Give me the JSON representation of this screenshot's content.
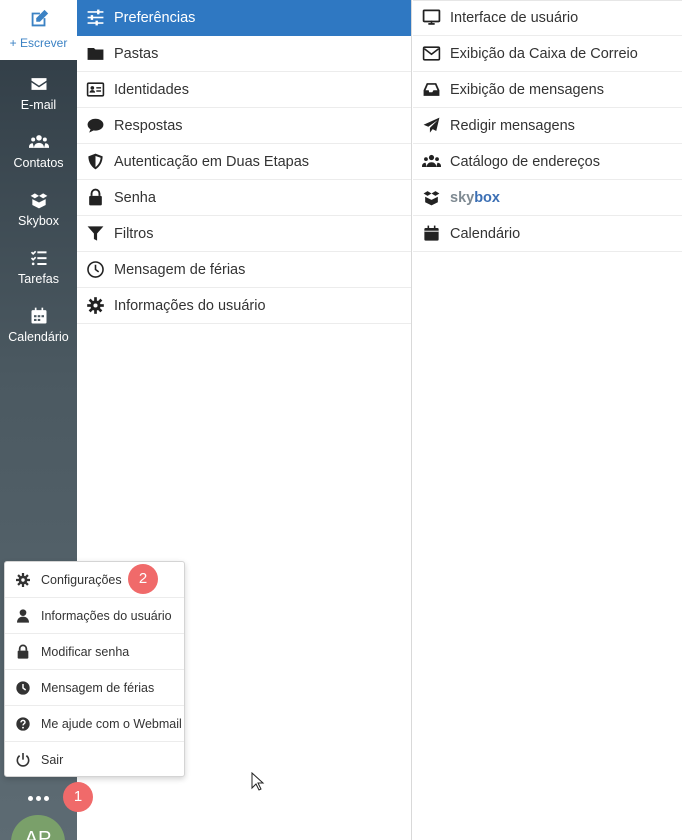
{
  "sidebar": {
    "compose_label": "+ Escrever",
    "items": [
      {
        "label": "E-mail",
        "icon": "envelope-icon"
      },
      {
        "label": "Contatos",
        "icon": "users-icon"
      },
      {
        "label": "Skybox",
        "icon": "box-icon"
      },
      {
        "label": "Tarefas",
        "icon": "tasks-icon"
      },
      {
        "label": "Calendário",
        "icon": "calendar-icon"
      }
    ],
    "avatar_initials": "AP"
  },
  "sections": [
    {
      "label": "Preferências",
      "icon": "sliders-icon",
      "active": true
    },
    {
      "label": "Pastas",
      "icon": "folder-icon"
    },
    {
      "label": "Identidades",
      "icon": "id-card-icon"
    },
    {
      "label": "Respostas",
      "icon": "comment-icon"
    },
    {
      "label": "Autenticação em Duas Etapas",
      "icon": "shield-icon"
    },
    {
      "label": "Senha",
      "icon": "lock-icon"
    },
    {
      "label": "Filtros",
      "icon": "filter-icon"
    },
    {
      "label": "Mensagem de férias",
      "icon": "clock-icon"
    },
    {
      "label": "Informações do usuário",
      "icon": "gear-icon"
    }
  ],
  "preferences": [
    {
      "label": "Interface de usuário",
      "icon": "monitor-icon"
    },
    {
      "label": "Exibição da Caixa de Correio",
      "icon": "envelope-outline-icon"
    },
    {
      "label": "Exibição de mensagens",
      "icon": "inbox-icon"
    },
    {
      "label": "Redigir mensagens",
      "icon": "paper-plane-icon"
    },
    {
      "label": "Catálogo de endereços",
      "icon": "users-icon"
    },
    {
      "label_part1": "sky",
      "label_part2": "box",
      "icon": "box-icon"
    },
    {
      "label": "Calendário",
      "icon": "calendar-icon"
    }
  ],
  "popup_menu": [
    {
      "label": "Configurações",
      "icon": "gear-icon"
    },
    {
      "label": "Informações do usuário",
      "icon": "user-icon"
    },
    {
      "label": "Modificar senha",
      "icon": "lock-icon"
    },
    {
      "label": "Mensagem de férias",
      "icon": "clock-icon"
    },
    {
      "label": "Me ajude com o Webmail",
      "icon": "question-circle-icon"
    },
    {
      "label": "Sair",
      "icon": "power-icon"
    }
  ],
  "badges": {
    "more_menu": "1",
    "settings": "2"
  },
  "colors": {
    "accent": "#2f78c2",
    "badge": "#f06a6a",
    "rail": "#4b5961",
    "compose": "#3b82c4"
  }
}
